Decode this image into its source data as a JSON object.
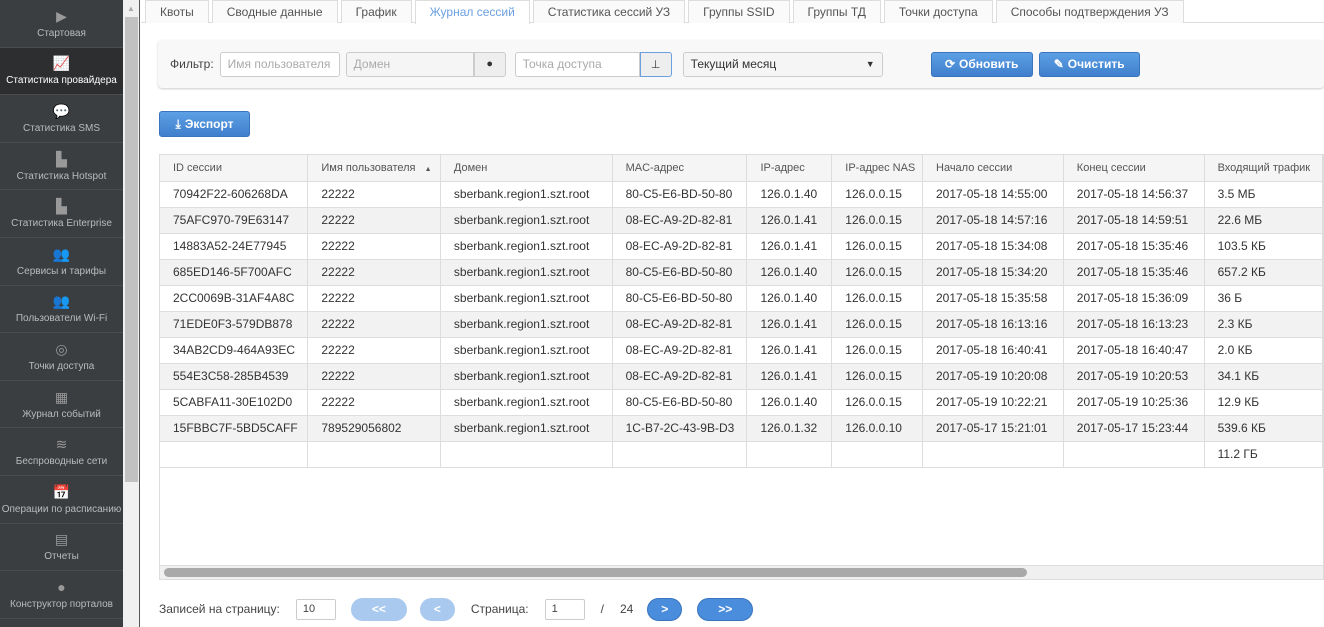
{
  "sidebar": {
    "items": [
      {
        "label": "Стартовая",
        "icon": "play-circle-icon",
        "glyph": "▶"
      },
      {
        "label": "Статистика провайдера",
        "icon": "line-chart-icon",
        "glyph": "📈",
        "active": true
      },
      {
        "label": "Статистика SMS",
        "icon": "chat-bubble-icon",
        "glyph": "💬"
      },
      {
        "label": "Статистика Hotspot",
        "icon": "bar-chart-icon",
        "glyph": "▙"
      },
      {
        "label": "Статистика Enterprise",
        "icon": "bar-chart-icon",
        "glyph": "▙"
      },
      {
        "label": "Сервисы и тарифы",
        "icon": "users-icon",
        "glyph": "👥"
      },
      {
        "label": "Пользователи Wi-Fi",
        "icon": "users-icon",
        "glyph": "👥"
      },
      {
        "label": "Точки доступа",
        "icon": "target-icon",
        "glyph": "◎"
      },
      {
        "label": "Журнал событий",
        "icon": "table-icon",
        "glyph": "▦"
      },
      {
        "label": "Беспроводные сети",
        "icon": "wifi-icon",
        "glyph": "≋"
      },
      {
        "label": "Операции по расписанию",
        "icon": "calendar-icon",
        "glyph": "📅"
      },
      {
        "label": "Отчеты",
        "icon": "file-icon",
        "glyph": "▤"
      },
      {
        "label": "Конструктор порталов",
        "icon": "globe-icon",
        "glyph": "●"
      }
    ]
  },
  "tabs": [
    "Квоты",
    "Сводные данные",
    "График",
    "Журнал сессий",
    "Статистика сессий УЗ",
    "Группы SSID",
    "Группы ТД",
    "Точки доступа",
    "Способы подтверждения УЗ"
  ],
  "active_tab": 3,
  "filter": {
    "label": "Фильтр:",
    "user_placeholder": "Имя пользователя",
    "domain_placeholder": "Домен",
    "ap_placeholder": "Точка доступа",
    "period": "Текущий месяц",
    "refresh": "Обновить",
    "clear": "Очистить"
  },
  "export": "Экспорт",
  "table": {
    "columns": [
      "ID сессии",
      "Имя пользователя",
      "Домен",
      "MAC-адрес",
      "IP-адрес",
      "IP-адрес NAS",
      "Начало сессии",
      "Конец сессии",
      "Входящий трафик"
    ],
    "sort_column": 1,
    "rows": [
      [
        "70942F22-606268DA",
        "22222",
        "sberbank.region1.szt.root",
        "80-C5-E6-BD-50-80",
        "126.0.1.40",
        "126.0.0.15",
        "2017-05-18 14:55:00",
        "2017-05-18 14:56:37",
        "3.5 МБ"
      ],
      [
        "75AFC970-79E63147",
        "22222",
        "sberbank.region1.szt.root",
        "08-EC-A9-2D-82-81",
        "126.0.1.41",
        "126.0.0.15",
        "2017-05-18 14:57:16",
        "2017-05-18 14:59:51",
        "22.6 МБ"
      ],
      [
        "14883A52-24E77945",
        "22222",
        "sberbank.region1.szt.root",
        "08-EC-A9-2D-82-81",
        "126.0.1.41",
        "126.0.0.15",
        "2017-05-18 15:34:08",
        "2017-05-18 15:35:46",
        "103.5 КБ"
      ],
      [
        "685ED146-5F700AFC",
        "22222",
        "sberbank.region1.szt.root",
        "80-C5-E6-BD-50-80",
        "126.0.1.40",
        "126.0.0.15",
        "2017-05-18 15:34:20",
        "2017-05-18 15:35:46",
        "657.2 КБ"
      ],
      [
        "2CC0069B-31AF4A8C",
        "22222",
        "sberbank.region1.szt.root",
        "80-C5-E6-BD-50-80",
        "126.0.1.40",
        "126.0.0.15",
        "2017-05-18 15:35:58",
        "2017-05-18 15:36:09",
        "36 Б"
      ],
      [
        "71EDE0F3-579DB878",
        "22222",
        "sberbank.region1.szt.root",
        "08-EC-A9-2D-82-81",
        "126.0.1.41",
        "126.0.0.15",
        "2017-05-18 16:13:16",
        "2017-05-18 16:13:23",
        "2.3 КБ"
      ],
      [
        "34AB2CD9-464A93EC",
        "22222",
        "sberbank.region1.szt.root",
        "08-EC-A9-2D-82-81",
        "126.0.1.41",
        "126.0.0.15",
        "2017-05-18 16:40:41",
        "2017-05-18 16:40:47",
        "2.0 КБ"
      ],
      [
        "554E3C58-285B4539",
        "22222",
        "sberbank.region1.szt.root",
        "08-EC-A9-2D-82-81",
        "126.0.1.41",
        "126.0.0.15",
        "2017-05-19 10:20:08",
        "2017-05-19 10:20:53",
        "34.1 КБ"
      ],
      [
        "5CABFA11-30E102D0",
        "22222",
        "sberbank.region1.szt.root",
        "80-C5-E6-BD-50-80",
        "126.0.1.40",
        "126.0.0.15",
        "2017-05-19 10:22:21",
        "2017-05-19 10:25:36",
        "12.9 КБ"
      ],
      [
        "15FBBC7F-5BD5CAFF",
        "789529056802",
        "sberbank.region1.szt.root",
        "1C-B7-2C-43-9B-D3",
        "126.0.1.32",
        "126.0.0.10",
        "2017-05-17 15:21:01",
        "2017-05-17 15:23:44",
        "539.6 КБ"
      ]
    ],
    "total": [
      "",
      "",
      "",
      "",
      "",
      "",
      "",
      "",
      "11.2 ГБ"
    ]
  },
  "pager": {
    "per_page_label": "Записей на страницу:",
    "per_page": "10",
    "first": "<<",
    "prev": "<",
    "page_label": "Страница:",
    "page": "1",
    "sep": "/",
    "total_pages": "24",
    "next": ">",
    "last": ">>"
  }
}
